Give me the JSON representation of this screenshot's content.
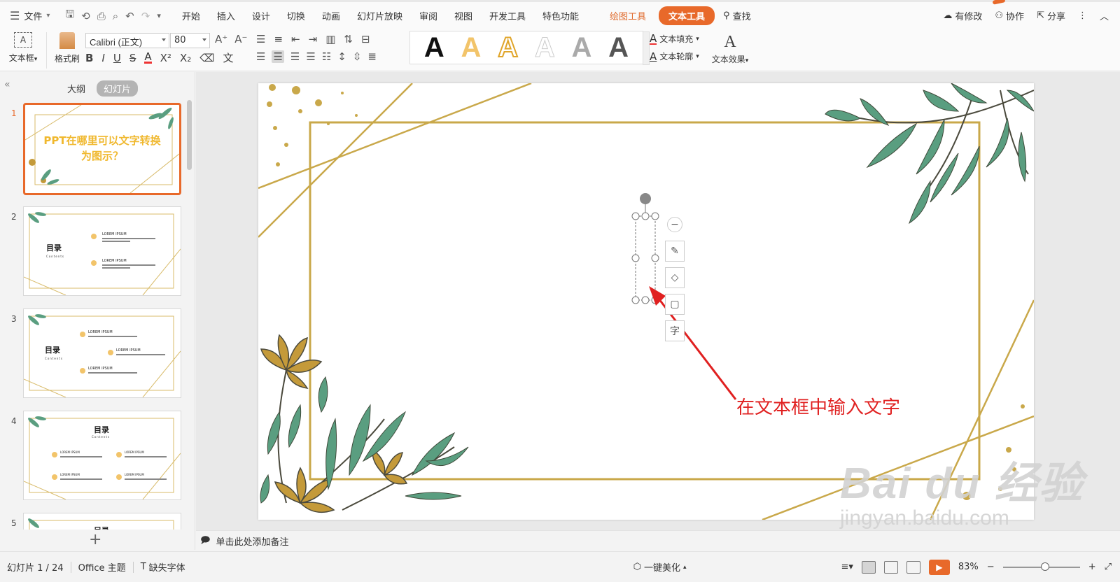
{
  "menu": {
    "file": "文件",
    "tabs": [
      "开始",
      "插入",
      "设计",
      "切换",
      "动画",
      "幻灯片放映",
      "审阅",
      "视图",
      "开发工具",
      "特色功能"
    ],
    "draw_tools": "绘图工具",
    "text_tools": "文本工具",
    "search": "查找",
    "right": {
      "modified": "有修改",
      "collab": "协作",
      "share": "分享"
    }
  },
  "ribbon": {
    "textbox": "文本框",
    "painter": "格式刷",
    "font": "Calibri (正文)",
    "size": "80",
    "text_fill": "文本填充",
    "text_outline": "文本轮廓",
    "text_effect": "文本效果",
    "style_letter": "A"
  },
  "sidebar": {
    "tab_outline": "大纲",
    "tab_slides": "幻灯片",
    "slides": [
      {
        "num": "1",
        "title": "PPT在哪里可以文字转换为图示？"
      },
      {
        "num": "2",
        "title": "目录",
        "sub": "Contents",
        "item": "LOREM IPSUM"
      },
      {
        "num": "3",
        "title": "目录",
        "sub": "Contents",
        "item": "LOREM IPSUM"
      },
      {
        "num": "4",
        "title": "目录",
        "sub": "Contents",
        "item": "LOREM IPSUM"
      },
      {
        "num": "5",
        "title": "目录"
      }
    ]
  },
  "canvas": {
    "annotation": "在文本框中输入文字",
    "float_tool_char": "字"
  },
  "notes": {
    "placeholder": "单击此处添加备注"
  },
  "status": {
    "slide": "幻灯片 1 / 24",
    "theme": "Office 主题",
    "missing_font": "缺失字体",
    "beautify": "一键美化",
    "zoom": "83%"
  },
  "watermark": {
    "line1": "Bai du 经验",
    "line2": "jingyan.baidu.com"
  },
  "colors": {
    "accent": "#e8692a",
    "gold": "#c9a84a",
    "leaf": "#5a9e80",
    "annotation": "#e02020"
  }
}
